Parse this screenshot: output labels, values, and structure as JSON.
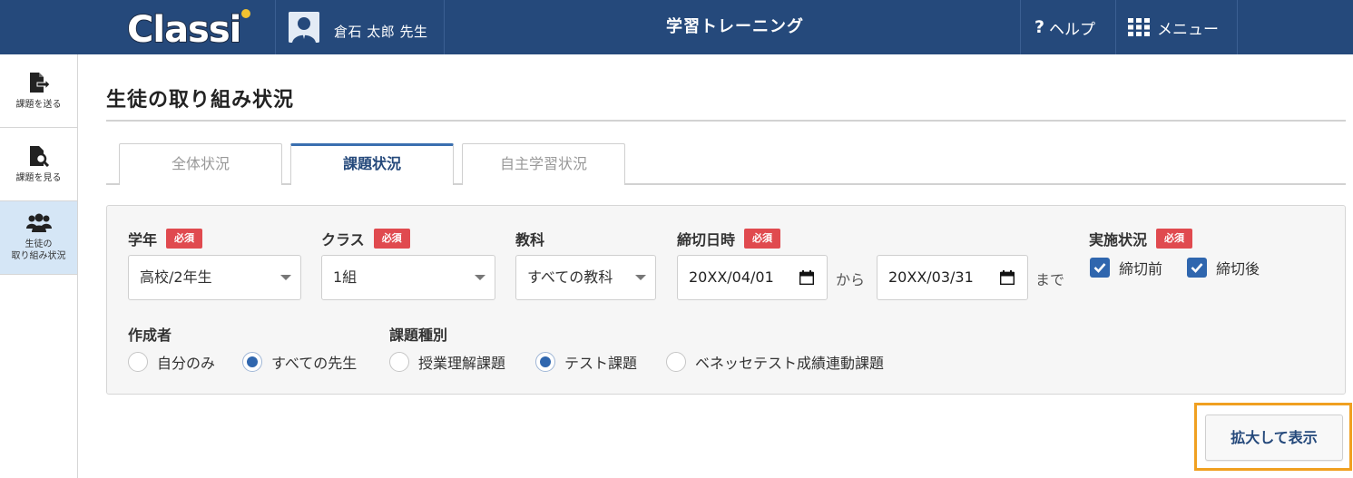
{
  "header": {
    "logo_text": "Classi",
    "user_name": "倉石 太郎 先生",
    "app_title": "学習トレーニング",
    "help_label": "ヘルプ",
    "menu_label": "メニュー",
    "bg_color": "#25497b"
  },
  "sidebar": {
    "items": [
      {
        "label": "課題を送る",
        "icon": "file-send-icon",
        "active": false
      },
      {
        "label": "課題を見る",
        "icon": "file-search-icon",
        "active": false
      },
      {
        "label_line1": "生徒の",
        "label_line2": "取り組み状況",
        "icon": "users-icon",
        "active": true
      }
    ]
  },
  "page": {
    "title": "生徒の取り組み状況"
  },
  "tabs": [
    {
      "label": "全体状況",
      "active": false
    },
    {
      "label": "課題状況",
      "active": true
    },
    {
      "label": "自主学習状況",
      "active": false
    }
  ],
  "filters": {
    "required_badge": "必須",
    "grade": {
      "label": "学年",
      "value": "高校/2年生"
    },
    "class": {
      "label": "クラス",
      "value": "1組"
    },
    "subject": {
      "label": "教科",
      "value": "すべての教科"
    },
    "deadline": {
      "label": "締切日時",
      "from": "20XX/04/01",
      "from_word": "から",
      "to": "20XX/03/31",
      "to_word": "まで"
    },
    "status": {
      "label": "実施状況",
      "options": [
        {
          "label": "締切前",
          "checked": true
        },
        {
          "label": "締切後",
          "checked": true
        }
      ]
    },
    "creator": {
      "label": "作成者",
      "options": [
        {
          "label": "自分のみ",
          "selected": false
        },
        {
          "label": "すべての先生",
          "selected": true
        }
      ]
    },
    "task_type": {
      "label": "課題種別",
      "options": [
        {
          "label": "授業理解課題",
          "selected": false
        },
        {
          "label": "テスト課題",
          "selected": true
        },
        {
          "label": "ベネッセテスト成績連動課題",
          "selected": false
        }
      ]
    }
  },
  "actions": {
    "expand_label": "拡大して表示",
    "highlight_color": "#f0a020"
  }
}
